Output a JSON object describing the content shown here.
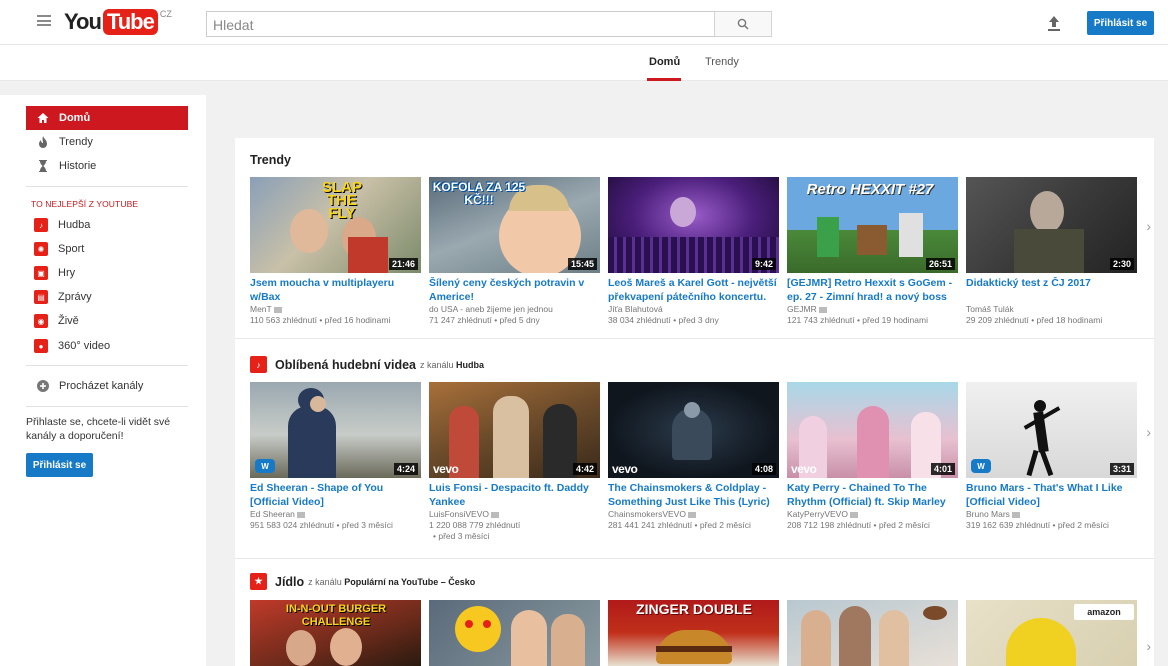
{
  "header": {
    "logo_you": "You",
    "logo_tube": "Tube",
    "logo_country": "CZ",
    "search_placeholder": "Hledat",
    "signin_label": "Přihlásit se"
  },
  "tabs": [
    {
      "label": "Domů",
      "active": true
    },
    {
      "label": "Trendy",
      "active": false
    }
  ],
  "sidebar": {
    "main_items": [
      {
        "label": "Domů",
        "icon": "home-icon",
        "active": true
      },
      {
        "label": "Trendy",
        "icon": "flame-icon",
        "active": false
      },
      {
        "label": "Historie",
        "icon": "hourglass-icon",
        "active": false
      }
    ],
    "best_of_heading": "TO NEJLEPŠÍ Z YOUTUBE",
    "best_of_items": [
      {
        "label": "Hudba",
        "icon": "music-note-icon"
      },
      {
        "label": "Sport",
        "icon": "ball-icon"
      },
      {
        "label": "Hry",
        "icon": "gamepad-icon"
      },
      {
        "label": "Zprávy",
        "icon": "newspaper-icon"
      },
      {
        "label": "Živě",
        "icon": "live-icon"
      },
      {
        "label": "360° video",
        "icon": "360-camera-icon"
      }
    ],
    "browse_channels": "Procházet kanály",
    "signin_prompt": "Přihlaste se, chcete-li vidět své kanály a doporučení!",
    "signin_label": "Přihlásit se"
  },
  "shelves": [
    {
      "title": "Trendy",
      "by_prefix": "",
      "by_channel": "",
      "videos": [
        {
          "title": "Jsem moucha v multiplayeru w/Bax",
          "channel": "MenT",
          "meta": "110 563 zhlédnutí • před 16 hodinami",
          "duration": "21:46",
          "overlay": "SLAP THE FLY"
        },
        {
          "title": "Šílený ceny českých potravin v Americe!",
          "channel": "do USA - aneb žijeme jen jednou",
          "meta": "71 247 zhlédnutí • před 5 dny",
          "duration": "15:45",
          "overlay": "KOFOLA ZA 125 KČ!!!"
        },
        {
          "title": "Leoš Mareš a Karel Gott - největší překvapení pátečního koncertu.",
          "channel": "Jíťa Blahutová",
          "meta": "38 034 zhlédnutí • před 3 dny",
          "duration": "9:42",
          "overlay": ""
        },
        {
          "title": "[GEJMR] Retro Hexxit s GoGem - ep. 27 - Zimní hrad! a nový boss",
          "channel": "GEJMR",
          "meta": "121 743 zhlédnutí • před 19 hodinami",
          "duration": "26:51",
          "overlay": "Retro HEXXIT #27"
        },
        {
          "title": "Didaktický test z ČJ 2017",
          "channel": "Tomáš Tulák",
          "meta": "29 209 zhlédnutí • před 18 hodinami",
          "duration": "2:30",
          "overlay": ""
        }
      ]
    },
    {
      "title": "Oblíbená hudební videa",
      "by_prefix": "z kanálu",
      "by_channel": "Hudba",
      "videos": [
        {
          "title": "Ed Sheeran - Shape of You [Official Video]",
          "channel": "Ed Sheeran",
          "meta": "951 583 024 zhlédnutí • před 3 měsíci",
          "duration": "4:24",
          "overlay": ""
        },
        {
          "title": "Luis Fonsi - Despacito ft. Daddy Yankee",
          "channel": "LuisFonsiVEVO",
          "meta": "1 220 088 779 zhlédnutí",
          "meta2": "• před 3 měsíci",
          "duration": "4:42",
          "overlay": "vevo"
        },
        {
          "title": "The Chainsmokers & Coldplay - Something Just Like This (Lyric)",
          "channel": "ChainsmokersVEVO",
          "meta": "281 441 241 zhlédnutí • před 2 měsíci",
          "duration": "4:08",
          "overlay": "vevo"
        },
        {
          "title": "Katy Perry - Chained To The Rhythm (Official) ft. Skip Marley",
          "channel": "KatyPerryVEVO",
          "meta": "208 712 198 zhlédnutí • před 2 měsíci",
          "duration": "4:01",
          "overlay": "vevo"
        },
        {
          "title": "Bruno Mars - That's What I Like [Official Video]",
          "channel": "Bruno Mars",
          "meta": "319 162 639 zhlédnutí • před 2 měsíci",
          "duration": "3:31",
          "overlay": ""
        }
      ]
    },
    {
      "title": "Jídlo",
      "by_prefix": "z kanálu",
      "by_channel": "Populární na YouTube – Česko",
      "videos": [
        {
          "overlay": "IN-N-OUT BURGER CHALLENGE"
        },
        {
          "overlay": ""
        },
        {
          "overlay": "ZINGER DOUBLE"
        },
        {
          "overlay": ""
        },
        {
          "overlay": "amazon"
        }
      ]
    }
  ],
  "colors": {
    "brand_red": "#e62117",
    "active_red": "#cc181e",
    "link_blue": "#167ac6"
  }
}
